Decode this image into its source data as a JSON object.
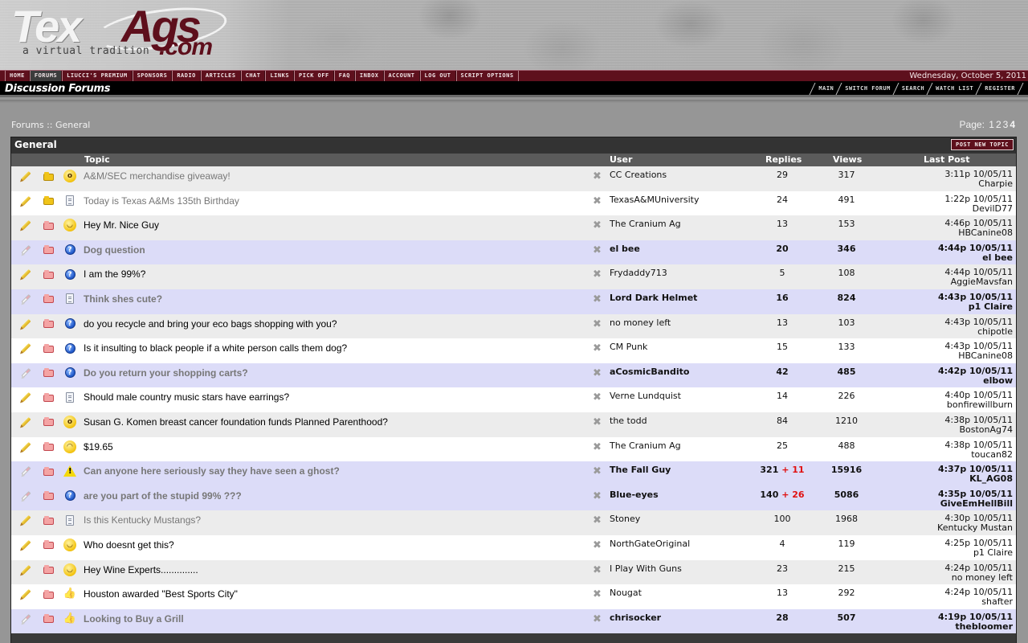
{
  "site": {
    "logo_main_white": "Tex",
    "logo_main_maroon": "Ags",
    "logo_suffix": ".com",
    "tagline": "a virtual tradition"
  },
  "nav": {
    "items": [
      {
        "label": "HOME",
        "active": false
      },
      {
        "label": "FORUMS",
        "active": true
      },
      {
        "label": "LIUCCI'S PREMIUM",
        "active": false
      },
      {
        "label": "SPONSORS",
        "active": false
      },
      {
        "label": "RADIO",
        "active": false
      },
      {
        "label": "ARTICLES",
        "active": false
      },
      {
        "label": "CHAT",
        "active": false
      },
      {
        "label": "LINKS",
        "active": false
      },
      {
        "label": "PICK OFF",
        "active": false
      },
      {
        "label": "FAQ",
        "active": false
      },
      {
        "label": "INBOX",
        "active": false
      },
      {
        "label": "ACCOUNT",
        "active": false
      },
      {
        "label": "LOG OUT",
        "active": false
      },
      {
        "label": "SCRIPT OPTIONS",
        "active": false
      }
    ],
    "date": "Wednesday, October 5, 2011"
  },
  "titlebar": {
    "title": "Discussion Forums",
    "links": [
      "MAIN",
      "SWITCH FORUM",
      "SEARCH",
      "WATCH LIST",
      "REGISTER"
    ]
  },
  "breadcrumb": {
    "root": "Forums",
    "separator": " :: ",
    "current": "General"
  },
  "pager": {
    "label": "Page:",
    "pages": [
      "1",
      "2",
      "3",
      "4"
    ],
    "current": "4"
  },
  "forum": {
    "title": "General",
    "post_button": "POST NEW TOPIC",
    "columns": {
      "topic": "Topic",
      "user": "User",
      "replies": "Replies",
      "views": "Views",
      "last_post": "Last Post"
    },
    "colors": {
      "row_gray": "#ececec",
      "row_white": "#ffffff",
      "row_unread": "#dcdcf8",
      "new_replies": "#e01010",
      "accent": "#5e101d"
    },
    "topics": [
      {
        "title": "A&M/SEC merchandise giveaway!",
        "icon": "shocked-face-icon",
        "folder": "yellow",
        "pencil": "yellow",
        "bg": "gray",
        "visited": true,
        "unread": false,
        "user": "CC Creations",
        "replies": "29",
        "new_replies": "",
        "views": "317",
        "last_time": "3:11p 10/05/11",
        "last_user": "Charpie"
      },
      {
        "title": "Today is Texas A&Ms 135th Birthday",
        "icon": "document-icon",
        "folder": "yellow",
        "pencil": "yellow",
        "bg": "white",
        "visited": true,
        "unread": false,
        "user": "TexasA&MUniversity",
        "replies": "24",
        "new_replies": "",
        "views": "491",
        "last_time": "1:22p 10/05/11",
        "last_user": "DevilD77"
      },
      {
        "title": "Hey Mr. Nice Guy",
        "icon": "smiley-icon",
        "folder": "red",
        "pencil": "yellow",
        "bg": "gray",
        "visited": false,
        "unread": false,
        "user": "The Cranium Ag",
        "replies": "13",
        "new_replies": "",
        "views": "153",
        "last_time": "4:46p 10/05/11",
        "last_user": "HBCanine08"
      },
      {
        "title": "Dog question",
        "icon": "question-icon",
        "folder": "red",
        "pencil": "eraser",
        "bg": "purple",
        "visited": true,
        "unread": true,
        "user": "el bee",
        "replies": "20",
        "new_replies": "",
        "views": "346",
        "last_time": "4:44p 10/05/11",
        "last_user": "el bee"
      },
      {
        "title": "I am the 99%?",
        "icon": "question-icon",
        "folder": "red",
        "pencil": "yellow",
        "bg": "gray",
        "visited": false,
        "unread": false,
        "user": "Frydaddy713",
        "replies": "5",
        "new_replies": "",
        "views": "108",
        "last_time": "4:44p 10/05/11",
        "last_user": "AggieMavsfan"
      },
      {
        "title": "Think shes cute?",
        "icon": "document-icon",
        "folder": "red",
        "pencil": "eraser",
        "bg": "purple",
        "visited": true,
        "unread": true,
        "user": "Lord Dark Helmet",
        "replies": "16",
        "new_replies": "",
        "views": "824",
        "last_time": "4:43p 10/05/11",
        "last_user": "p1 Claire"
      },
      {
        "title": "do you recycle and bring your eco bags shopping with you?",
        "icon": "question-icon",
        "folder": "red",
        "pencil": "yellow",
        "bg": "gray",
        "visited": false,
        "unread": false,
        "user": "no money left",
        "replies": "13",
        "new_replies": "",
        "views": "103",
        "last_time": "4:43p 10/05/11",
        "last_user": "chipotle"
      },
      {
        "title": "Is it insulting to black people if a white person calls them dog?",
        "icon": "question-icon",
        "folder": "red",
        "pencil": "yellow",
        "bg": "white",
        "visited": false,
        "unread": false,
        "user": "CM Punk",
        "replies": "15",
        "new_replies": "",
        "views": "133",
        "last_time": "4:43p 10/05/11",
        "last_user": "HBCanine08"
      },
      {
        "title": "Do you return your shopping carts?",
        "icon": "question-icon",
        "folder": "red",
        "pencil": "eraser",
        "bg": "purple",
        "visited": true,
        "unread": true,
        "user": "aCosmicBandito",
        "replies": "42",
        "new_replies": "",
        "views": "485",
        "last_time": "4:42p 10/05/11",
        "last_user": "elbow"
      },
      {
        "title": "Should male country music stars have earrings?",
        "icon": "document-icon",
        "folder": "red",
        "pencil": "yellow",
        "bg": "white",
        "visited": false,
        "unread": false,
        "user": "Verne Lundquist",
        "replies": "14",
        "new_replies": "",
        "views": "226",
        "last_time": "4:40p 10/05/11",
        "last_user": "bonfirewillburn"
      },
      {
        "title": "Susan G. Komen breast cancer foundation funds Planned Parenthood?",
        "icon": "shocked-face-icon",
        "folder": "red",
        "pencil": "yellow",
        "bg": "gray",
        "visited": false,
        "unread": false,
        "user": "the todd",
        "replies": "84",
        "new_replies": "",
        "views": "1210",
        "last_time": "4:38p 10/05/11",
        "last_user": "BostonAg74"
      },
      {
        "title": "$19.65",
        "icon": "sad-face-icon",
        "folder": "red",
        "pencil": "yellow",
        "bg": "white",
        "visited": false,
        "unread": false,
        "user": "The Cranium Ag",
        "replies": "25",
        "new_replies": "",
        "views": "488",
        "last_time": "4:38p 10/05/11",
        "last_user": "toucan82"
      },
      {
        "title": "Can anyone here seriously say they have seen a ghost?",
        "icon": "warning-icon",
        "folder": "red",
        "pencil": "eraser",
        "bg": "purple",
        "visited": true,
        "unread": true,
        "user": "The Fall Guy",
        "replies": "321",
        "new_replies": "+ 11",
        "views": "15916",
        "last_time": "4:37p 10/05/11",
        "last_user": "KL_AG08"
      },
      {
        "title": "are you part of the stupid 99% ???",
        "icon": "question-icon",
        "folder": "red",
        "pencil": "eraser",
        "bg": "purple",
        "visited": true,
        "unread": true,
        "user": "Blue-eyes",
        "replies": "140",
        "new_replies": "+ 26",
        "views": "5086",
        "last_time": "4:35p 10/05/11",
        "last_user": "GiveEmHellBill"
      },
      {
        "title": "Is this Kentucky Mustangs?",
        "icon": "document-icon",
        "folder": "red",
        "pencil": "yellow",
        "bg": "gray",
        "visited": true,
        "unread": false,
        "user": "Stoney",
        "replies": "100",
        "new_replies": "",
        "views": "1968",
        "last_time": "4:30p 10/05/11",
        "last_user": "Kentucky Mustan"
      },
      {
        "title": "Who doesnt get this?",
        "icon": "smiley-icon",
        "folder": "red",
        "pencil": "yellow",
        "bg": "white",
        "visited": false,
        "unread": false,
        "user": "NorthGateOriginal",
        "replies": "4",
        "new_replies": "",
        "views": "119",
        "last_time": "4:25p 10/05/11",
        "last_user": "p1 Claire"
      },
      {
        "title": "Hey Wine Experts..............",
        "icon": "smiley-icon",
        "folder": "red",
        "pencil": "yellow",
        "bg": "gray",
        "visited": false,
        "unread": false,
        "user": "I Play With Guns",
        "replies": "23",
        "new_replies": "",
        "views": "215",
        "last_time": "4:24p 10/05/11",
        "last_user": "no money left"
      },
      {
        "title": "Houston awarded \"Best Sports City\"",
        "icon": "thumbs-up-icon",
        "folder": "red",
        "pencil": "yellow",
        "bg": "white",
        "visited": false,
        "unread": false,
        "user": "Nougat",
        "replies": "13",
        "new_replies": "",
        "views": "292",
        "last_time": "4:24p 10/05/11",
        "last_user": "shafter"
      },
      {
        "title": "Looking to Buy a Grill",
        "icon": "thumbs-up-icon",
        "folder": "red",
        "pencil": "eraser",
        "bg": "purple",
        "visited": true,
        "unread": true,
        "user": "chrisocker",
        "replies": "28",
        "new_replies": "",
        "views": "507",
        "last_time": "4:19p 10/05/11",
        "last_user": "thebloomer"
      }
    ]
  }
}
